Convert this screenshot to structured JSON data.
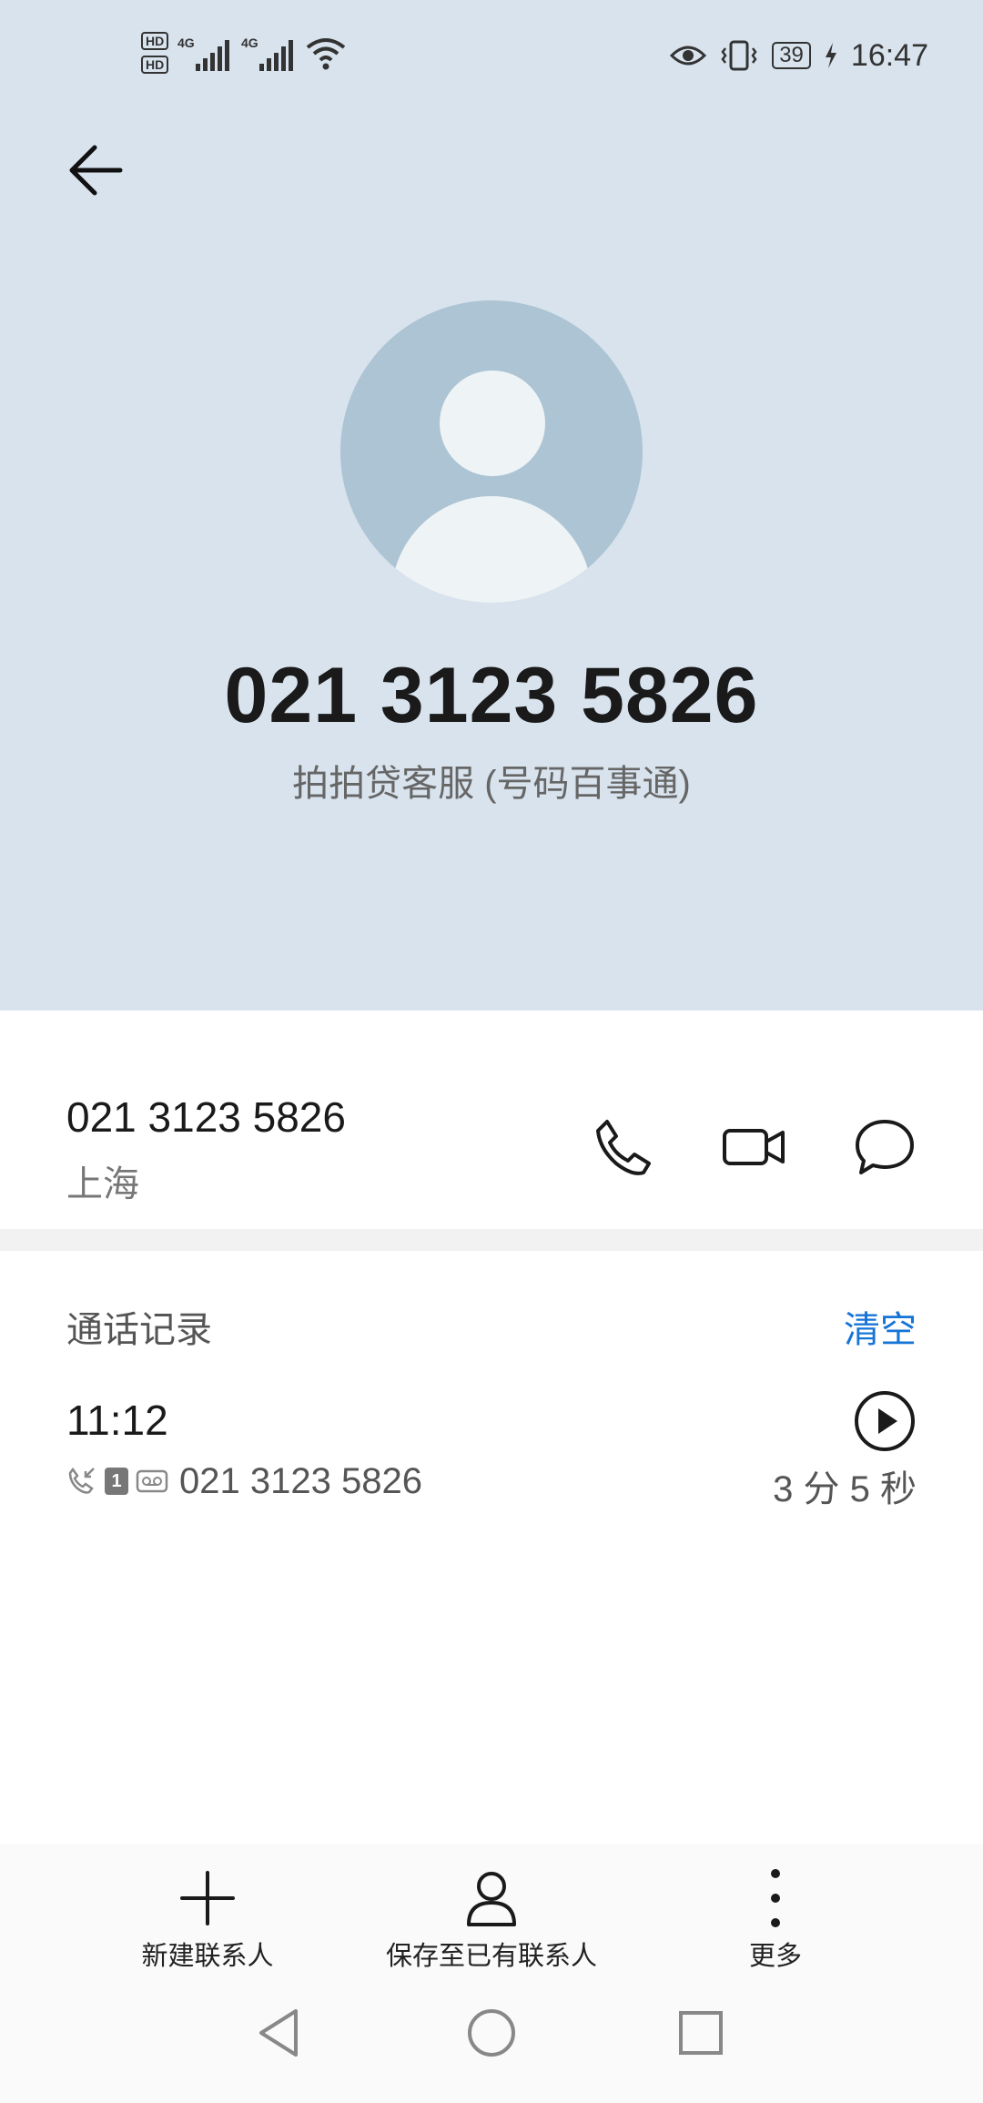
{
  "status_bar": {
    "hd1": "HD",
    "hd2": "HD",
    "net1": "4G",
    "net2": "4G",
    "battery": "39",
    "time": "16:47"
  },
  "contact": {
    "number": "021 3123 5826",
    "caller_id": "拍拍贷客服 (号码百事通)"
  },
  "info": {
    "number": "021 3123 5826",
    "location": "上海"
  },
  "call_log": {
    "title": "通话记录",
    "clear_label": "清空",
    "entries": [
      {
        "time": "11:12",
        "sim": "1",
        "number": "021 3123 5826",
        "duration": "3 分 5 秒"
      }
    ]
  },
  "bottom_actions": {
    "new_contact": "新建联系人",
    "save_existing": "保存至已有联系人",
    "more": "更多"
  },
  "colors": {
    "header_bg": "#d8e3ed",
    "accent": "#1674d6",
    "avatar_bg": "#acc4d3"
  }
}
